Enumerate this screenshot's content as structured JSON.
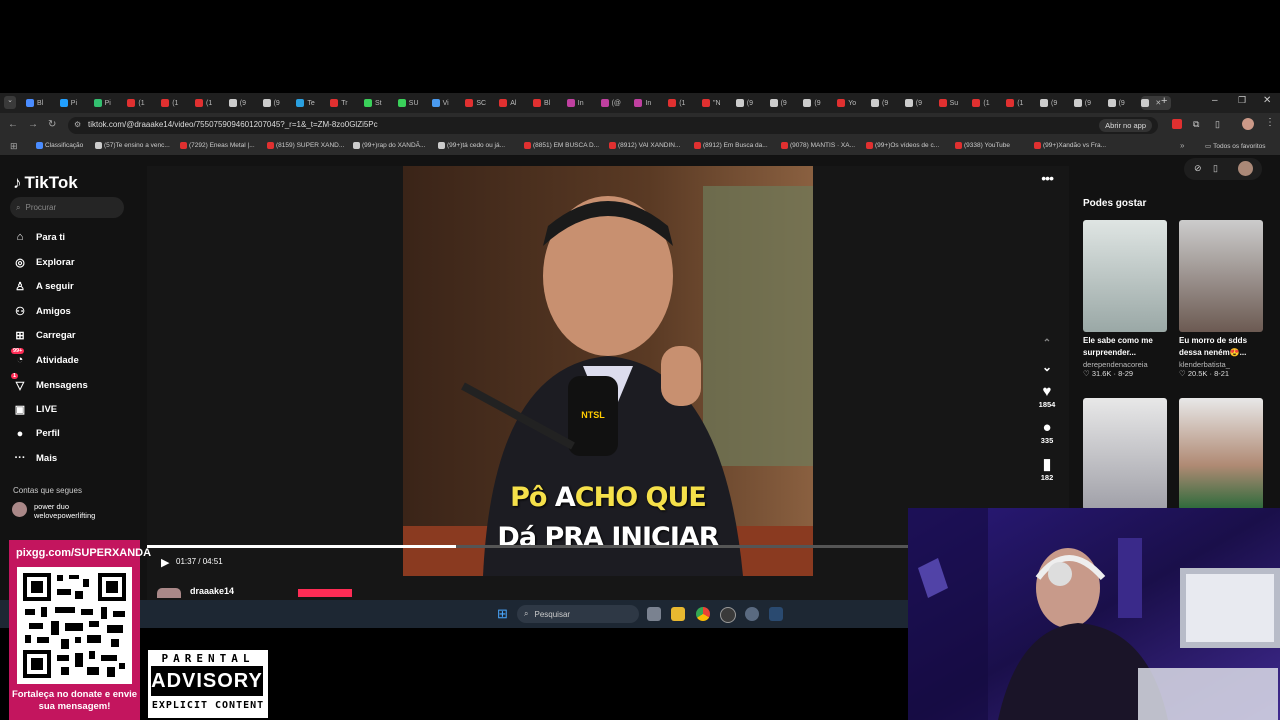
{
  "browser": {
    "url": "tiktok.com/@draaake14/video/7550759094601207045?_r=1&_t=ZM-8zo0GlZi5Pc",
    "open_in_app": "Abrir no app",
    "tabs": [
      "Bl",
      "Pi",
      "Pi",
      "(1",
      "(1",
      "(1",
      "(9",
      "(9",
      "Te",
      "Tr",
      "St",
      "SU",
      "Vi",
      "SC",
      "Al",
      "Bl",
      "In",
      "(@",
      "In",
      "(1",
      "\"N",
      "(9",
      "(9",
      "(9",
      "Yo",
      "(9",
      "(9",
      "Su",
      "(1",
      "(1",
      "(9",
      "(9",
      "(9",
      ""
    ],
    "bookmarks": [
      "Classificação",
      "(57)Te ensino a venc...",
      "(7292) Eneas Metal |...",
      "(8159) SUPER XAND...",
      "(99+)rap do XANDÃ...",
      "(99+)tá cedo ou já...",
      "(8851) EM BUSCA D...",
      "(8912) VAI XANDIN...",
      "(8912) Em Busca da...",
      "(9078) MANTIS · XA...",
      "(99+)Os vídeos de c...",
      "(9338) YouTube",
      "(99+)Xandão vs Fra..."
    ],
    "all_favorites": "Todos os favoritos"
  },
  "tiktok": {
    "logo": "TikTok",
    "search_placeholder": "Procurar",
    "nav": [
      {
        "label": "Para ti",
        "icon": "home-icon",
        "glyph": "⌂"
      },
      {
        "label": "Explorar",
        "icon": "compass-icon",
        "glyph": "◎"
      },
      {
        "label": "A seguir",
        "icon": "following-icon",
        "glyph": "♙"
      },
      {
        "label": "Amigos",
        "icon": "friends-icon",
        "glyph": "⚇"
      },
      {
        "label": "Carregar",
        "icon": "upload-icon",
        "glyph": "⊞"
      },
      {
        "label": "Atividade",
        "icon": "activity-icon",
        "glyph": "◔",
        "badge": "99+"
      },
      {
        "label": "Mensagens",
        "icon": "messages-icon",
        "glyph": "▽",
        "badge": "1"
      },
      {
        "label": "LIVE",
        "icon": "live-icon",
        "glyph": "▣"
      },
      {
        "label": "Perfil",
        "icon": "profile-icon",
        "glyph": "●"
      },
      {
        "label": "Mais",
        "icon": "more-icon",
        "glyph": "···"
      }
    ],
    "following_title": "Contas que segues",
    "following": [
      {
        "name": "power duo",
        "handle": "welovepowerlifting"
      }
    ],
    "video": {
      "caption_line1_pre": "Pô ",
      "caption_line1_hl": "A",
      "caption_line1_post": "CHO QUE",
      "caption_line2": "Dá PRA INICIAR",
      "mic_brand": "NTSL",
      "time": "01:37 / 04:51",
      "progress": 0.335,
      "likes": "1854",
      "comments": "335",
      "saves": "182",
      "author": "draaake14"
    },
    "recommended_title": "Podes gostar",
    "recommended": [
      {
        "title": "Ele sabe como me surpreender...",
        "author": "derependenacoreia",
        "likes": "31.6K",
        "date": "8-29"
      },
      {
        "title": "Eu morro de sdds dessa neném😍...",
        "author": "klenderbatista_",
        "likes": "20.5K",
        "date": "8-21"
      }
    ]
  },
  "taskbar": {
    "search_placeholder": "Pesquisar"
  },
  "overlay": {
    "donate_url": "pixgg.com/SUPERXANDA",
    "donate_msg": "Fortaleça no donate e envie sua mensagem!",
    "advisory_top": "PARENTAL",
    "advisory_mid": "ADVISORY",
    "advisory_bottom": "EXPLICIT CONTENT"
  },
  "colors": {
    "accent": "#fe2c55",
    "page_bg": "#121212",
    "donate_bg": "#c3155e",
    "caption_yellow": "#f5e04a"
  }
}
